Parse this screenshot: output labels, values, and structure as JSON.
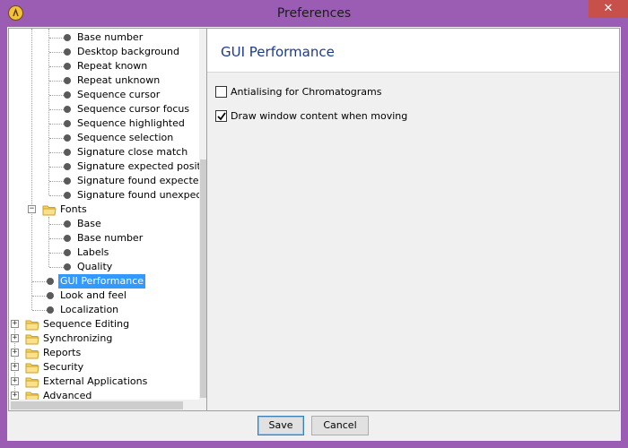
{
  "window": {
    "title": "Preferences",
    "close_glyph": "✕"
  },
  "tree": {
    "color_items": [
      "Base number",
      "Desktop background",
      "Repeat known",
      "Repeat unknown",
      "Sequence cursor",
      "Sequence cursor focus",
      "Sequence highlighted",
      "Sequence selection",
      "Signature close match",
      "Signature expected position",
      "Signature found expected",
      "Signature found unexpected"
    ],
    "fonts_label": "Fonts",
    "font_items": [
      "Base",
      "Base number",
      "Labels",
      "Quality"
    ],
    "appearance_items": [
      "GUI Performance",
      "Look and feel",
      "Localization"
    ],
    "selected_item": "GUI Performance",
    "root_items": [
      "Sequence Editing",
      "Synchronizing",
      "Reports",
      "Security",
      "External Applications",
      "Advanced"
    ]
  },
  "panel": {
    "title": "GUI Performance",
    "options": [
      {
        "label": "Antialising for Chromatograms",
        "checked": false
      },
      {
        "label": "Draw window content when moving",
        "checked": true
      }
    ]
  },
  "buttons": {
    "save": "Save",
    "cancel": "Cancel"
  },
  "colors": {
    "title_bar": "#9b5cb3",
    "selection": "#3399ff",
    "panel_title": "#1b3a8c",
    "close_button": "#c7504a"
  },
  "icons": {
    "app": "app-logo-icon",
    "folder": "folder-icon",
    "leaf": "bullet-icon",
    "expand": "plus-expander-icon",
    "collapse": "minus-expander-icon",
    "check": "checkmark-icon"
  }
}
